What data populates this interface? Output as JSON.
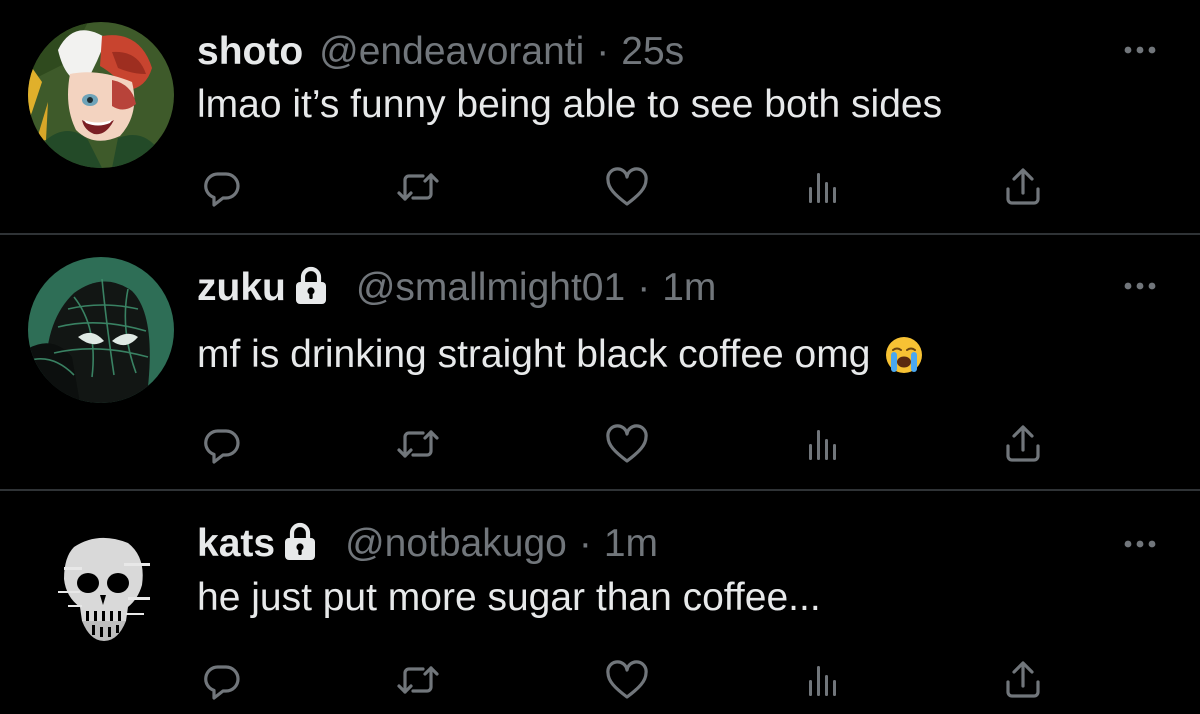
{
  "colors": {
    "background": "#000000",
    "primary_text": "#e7e9ea",
    "secondary_text": "#71767b",
    "divider": "#2f3336"
  },
  "tweets": [
    {
      "display_name": "shoto",
      "protected": false,
      "handle": "@endeavoranti",
      "separator": "·",
      "time": "25s",
      "text": "lmao it’s funny being able to see both sides",
      "emoji": ""
    },
    {
      "display_name": "zuku",
      "protected": true,
      "handle": "@smallmight01",
      "separator": "·",
      "time": "1m",
      "text": "mf is drinking straight black coffee omg",
      "emoji": "sob-emoji"
    },
    {
      "display_name": "kats",
      "protected": true,
      "handle": "@notbakugo",
      "separator": "·",
      "time": "1m",
      "text": "he just put more sugar than coffee...",
      "emoji": ""
    }
  ],
  "icons": {
    "more": "more-icon",
    "reply": "reply-icon",
    "retweet": "retweet-icon",
    "like": "heart-icon",
    "views": "views-icon",
    "share": "share-icon",
    "lock": "lock-icon"
  }
}
